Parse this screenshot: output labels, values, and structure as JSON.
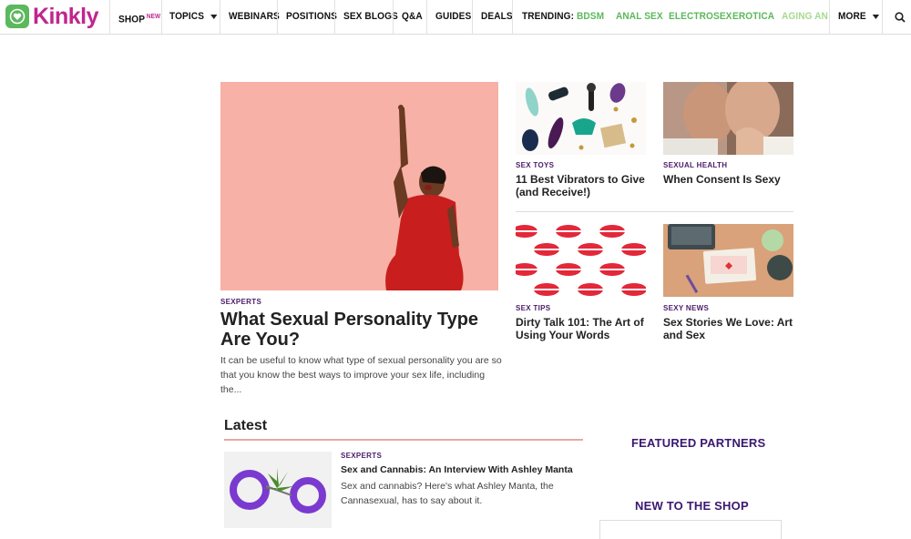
{
  "brand": {
    "name": "Kinkly",
    "primary_color": "#c0268d",
    "accent_color": "#5cb85c"
  },
  "nav": {
    "shop": "SHOP",
    "shop_badge": "NEW",
    "topics": "TOPICS",
    "webinars": "WEBINARS",
    "positions": "POSITIONS",
    "sex_blogs": "SEX BLOGS",
    "qa": "Q&A",
    "guides": "GUIDES",
    "deals": "DEALS",
    "trending_label": "TRENDING:",
    "trending": [
      "BDSM",
      "ANAL SEX",
      "ELECTROSEX",
      "EROTICA",
      "AGING AND S"
    ],
    "more": "MORE",
    "search_icon": "search-icon"
  },
  "hero": {
    "category": "SEXPERTS",
    "title": "What Sexual Personality Type Are You?",
    "excerpt": "It can be useful to know what type of sexual personality you are so that you know the best ways to improve your sex life, including the..."
  },
  "cards": [
    {
      "category": "SEX TOYS",
      "title": "11 Best Vibrators to Give (and Receive!)"
    },
    {
      "category": "SEXUAL HEALTH",
      "title": "When Consent Is Sexy"
    },
    {
      "category": "SEX TIPS",
      "title": "Dirty Talk 101: The Art of Using Your Words"
    },
    {
      "category": "SEXY NEWS",
      "title": "Sex Stories We Love: Art and Sex"
    }
  ],
  "latest": {
    "heading": "Latest",
    "items": [
      {
        "category": "SEXPERTS",
        "title": "Sex and Cannabis: An Interview With Ashley Manta",
        "excerpt": "Sex and cannabis? Here's what Ashley Manta, the Cannasexual, has to say about it."
      }
    ]
  },
  "sidebar": {
    "featured_partners": "FEATURED PARTNERS",
    "new_to_shop": "NEW TO THE SHOP"
  }
}
